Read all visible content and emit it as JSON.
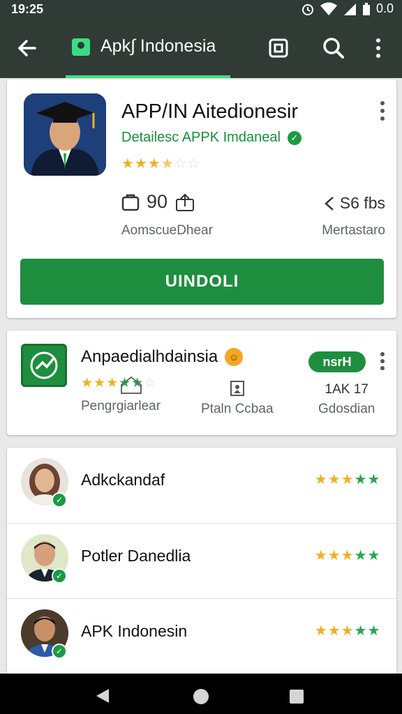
{
  "status": {
    "time": "19:25",
    "battery_text": "0.0",
    "icons": [
      "alarm-icon",
      "wifi-icon",
      "signal-icon",
      "battery-icon"
    ]
  },
  "toolbar": {
    "title": "Apk∫ Indonesia",
    "active_tab_color": "#3ddc84",
    "actions": [
      "back-icon",
      "store-icon",
      "cast-icon",
      "search-icon",
      "overflow-icon"
    ]
  },
  "featured_app": {
    "name": "APP/IN Aitedionesir",
    "developer": "Detailesc APPK Imdaneal",
    "rating": 3.5,
    "stat_size": "90",
    "stat_size_label": "AomscueDhear",
    "stat_right": "S6 fbs",
    "stat_right_label": "Mertastaro",
    "install_label": "UINDOLI"
  },
  "second_app": {
    "name": "Anpaedialhdainsia",
    "rating": 3,
    "badge": "nsrH",
    "meta": [
      {
        "label": "Pengrgiarlear"
      },
      {
        "label": "Ptaln Ccbaa"
      },
      {
        "value": "1AK 17",
        "label": "Gdosdian"
      }
    ]
  },
  "reviewers": [
    {
      "name": "Adkckandaf",
      "rating": 5
    },
    {
      "name": "Potler Danedlia",
      "rating": 5
    },
    {
      "name": "APK Indonesin",
      "rating": 5
    }
  ],
  "colors": {
    "toolbar": "#303b36",
    "accent_green": "#1e8e3e",
    "star_yellow": "#f2b01e",
    "star_green": "#22a84a"
  }
}
